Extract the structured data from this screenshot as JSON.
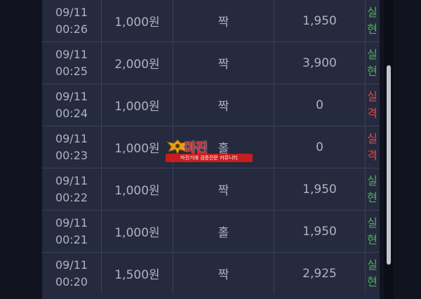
{
  "rows": [
    {
      "date": "09/11",
      "time": "00:26",
      "amount": "1,000원",
      "pick": "짝",
      "payout": "1,950",
      "result": [
        "실",
        "현"
      ],
      "status": "win"
    },
    {
      "date": "09/11",
      "time": "00:25",
      "amount": "2,000원",
      "pick": "짝",
      "payout": "3,900",
      "result": [
        "실",
        "현"
      ],
      "status": "win"
    },
    {
      "date": "09/11",
      "time": "00:24",
      "amount": "1,000원",
      "pick": "짝",
      "payout": "0",
      "result": [
        "실",
        "격"
      ],
      "status": "lose"
    },
    {
      "date": "09/11",
      "time": "00:23",
      "amount": "1,000원",
      "pick": "홀",
      "payout": "0",
      "result": [
        "실",
        "격"
      ],
      "status": "lose"
    },
    {
      "date": "09/11",
      "time": "00:22",
      "amount": "1,000원",
      "pick": "짝",
      "payout": "1,950",
      "result": [
        "실",
        "현"
      ],
      "status": "win"
    },
    {
      "date": "09/11",
      "time": "00:21",
      "amount": "1,000원",
      "pick": "홀",
      "payout": "1,950",
      "result": [
        "실",
        "현"
      ],
      "status": "win"
    },
    {
      "date": "09/11",
      "time": "00:20",
      "amount": "1,500원",
      "pick": "짝",
      "payout": "2,925",
      "result": [
        "실",
        "현"
      ],
      "status": "win"
    }
  ],
  "watermark": {
    "title": "마진",
    "subtitle": "마진거래 검증전문 커뮤니티"
  },
  "colors": {
    "win": "#4caf57",
    "lose": "#e04545",
    "background": "#252a3e"
  }
}
